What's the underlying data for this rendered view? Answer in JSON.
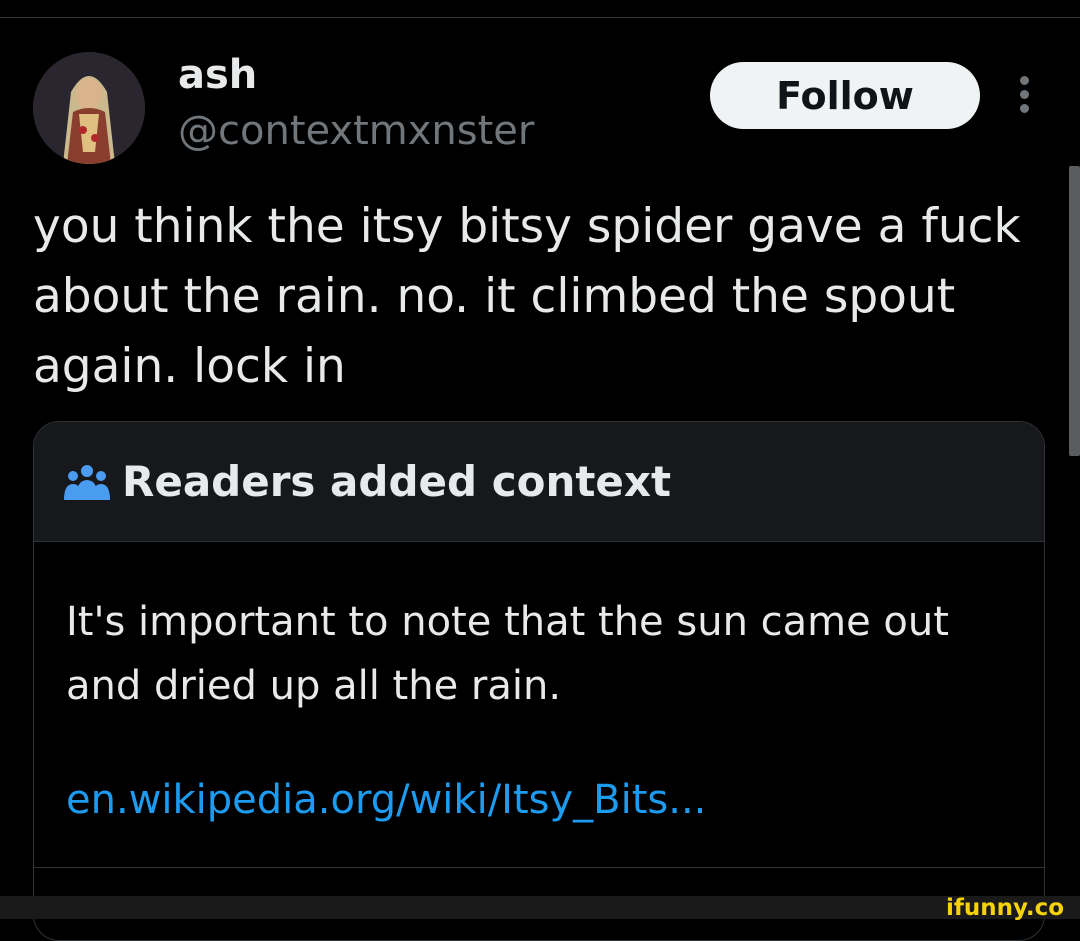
{
  "tweet": {
    "author_name": "ash",
    "author_handle": "@contextmxnster",
    "follow_label": "Follow",
    "text": "you think the itsy bitsy spider gave a fuck about the rain. no. it climbed the spout again. lock in"
  },
  "community_note": {
    "title": "Readers added context",
    "icon": "people-group-icon",
    "body": "It's important to note that the sun came out and dried up all the rain.",
    "link_text": "en.wikipedia.org/wiki/Itsy_Bits..."
  },
  "watermark": "ifunny.co",
  "colors": {
    "background": "#000000",
    "text": "#e7e9ea",
    "muted": "#71767b",
    "link": "#1d9bf0",
    "note_header": "#16181c",
    "watermark": "#f5d20a"
  }
}
